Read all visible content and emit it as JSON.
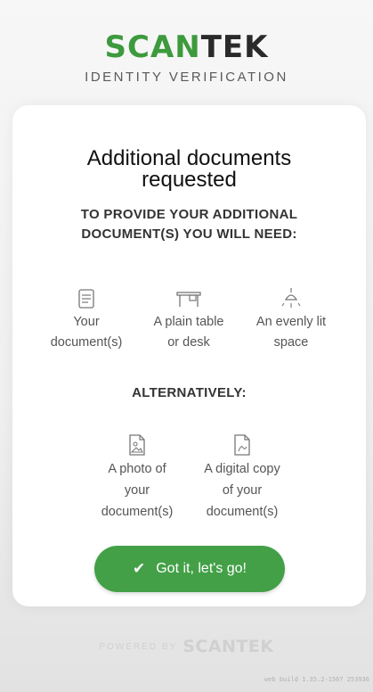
{
  "header": {
    "logo_part1": "SCAN",
    "logo_part2": "TEK",
    "tagline": "IDENTITY VERIFICATION"
  },
  "card": {
    "title_line1": "Additional documents",
    "title_line2": "requested",
    "subtitle_line1": "TO PROVIDE YOUR ADDITIONAL",
    "subtitle_line2": "DOCUMENT(S) YOU WILL NEED:",
    "requirements": [
      {
        "icon": "document-icon",
        "line1": "Your",
        "line2": "document(s)"
      },
      {
        "icon": "table-icon",
        "line1": "A plain table",
        "line2": "or desk"
      },
      {
        "icon": "lamp-icon",
        "line1": "An evenly lit",
        "line2": "space"
      }
    ],
    "alternatively": "ALTERNATIVELY:",
    "alternatives": [
      {
        "icon": "photo-file-icon",
        "line1": "A photo of",
        "line2": "your",
        "line3": "document(s)"
      },
      {
        "icon": "pdf-file-icon",
        "line1": "A digital copy",
        "line2": "of your",
        "line3": "document(s)"
      }
    ],
    "button_label": "Got it, let's go!"
  },
  "footer": {
    "powered_by": "POWERED BY",
    "logo": "SCANTEK",
    "build": "web build 1.35.2-1567 253936"
  },
  "colors": {
    "brand_green": "#3d9a3d",
    "button_green": "#43a047"
  }
}
